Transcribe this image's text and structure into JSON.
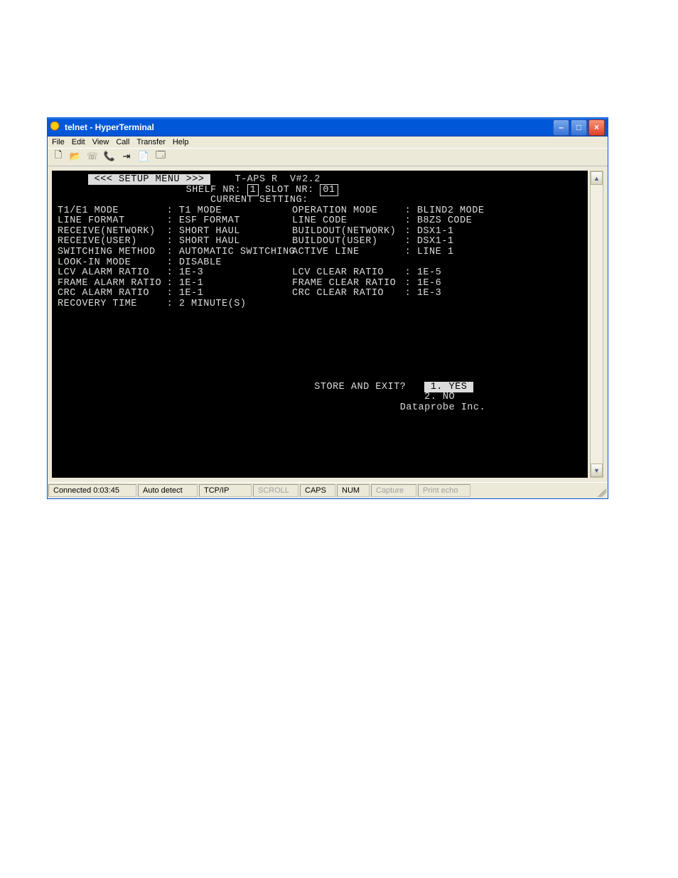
{
  "window": {
    "title": "telnet - HyperTerminal"
  },
  "menu": {
    "items": [
      "File",
      "Edit",
      "View",
      "Call",
      "Transfer",
      "Help"
    ]
  },
  "toolbar_icons": [
    "new-file-icon",
    "open-file-icon",
    "connect-icon",
    "disconnect-icon",
    "send-icon",
    "receive-icon",
    "properties-icon"
  ],
  "terminal": {
    "header": {
      "menu_label": " <<< SETUP MENU >>> ",
      "product": "T-APS R  V#2.2",
      "shelf_label": "SHELF NR:",
      "shelf_nr": "1",
      "slot_label": "SLOT NR:",
      "slot_nr": "01",
      "current_setting": "CURRENT SETTING:"
    },
    "settings": {
      "left": [
        {
          "label": "T1/E1 MODE",
          "value": "T1 MODE"
        },
        {
          "label": "LINE FORMAT",
          "value": "ESF FORMAT"
        },
        {
          "label": "RECEIVE(NETWORK)",
          "value": "SHORT HAUL"
        },
        {
          "label": "RECEIVE(USER)",
          "value": "SHORT HAUL"
        },
        {
          "label": "SWITCHING METHOD",
          "value": "AUTOMATIC SWITCHING"
        },
        {
          "label": "LOOK-IN MODE",
          "value": "DISABLE"
        },
        {
          "label": "LCV ALARM RATIO",
          "value": "1E-3"
        },
        {
          "label": "FRAME ALARM RATIO",
          "value": "1E-1"
        },
        {
          "label": "CRC ALARM RATIO",
          "value": "1E-1"
        },
        {
          "label": "RECOVERY TIME",
          "value": "2 MINUTE(S)"
        }
      ],
      "right": [
        {
          "label": "OPERATION MODE",
          "value": "BLIND2 MODE"
        },
        {
          "label": "LINE CODE",
          "value": "B8ZS CODE"
        },
        {
          "label": "BUILDOUT(NETWORK)",
          "value": "DSX1-1"
        },
        {
          "label": "BUILDOUT(USER)",
          "value": "DSX1-1"
        },
        {
          "label": "ACTIVE LINE",
          "value": "LINE 1"
        },
        {
          "label": "",
          "value": ""
        },
        {
          "label": "LCV CLEAR RATIO",
          "value": "1E-5"
        },
        {
          "label": "FRAME CLEAR RATIO",
          "value": "1E-6"
        },
        {
          "label": "CRC CLEAR RATIO",
          "value": "1E-3"
        }
      ]
    },
    "prompt": {
      "question": "STORE AND EXIT?",
      "opt1": " 1. YES ",
      "opt2": "2. NO",
      "company": "Dataprobe Inc."
    }
  },
  "status": {
    "connected": "Connected 0:03:45",
    "detect": "Auto detect",
    "proto": "TCP/IP",
    "scroll": "SCROLL",
    "caps": "CAPS",
    "num": "NUM",
    "capture": "Capture",
    "echo": "Print echo"
  }
}
